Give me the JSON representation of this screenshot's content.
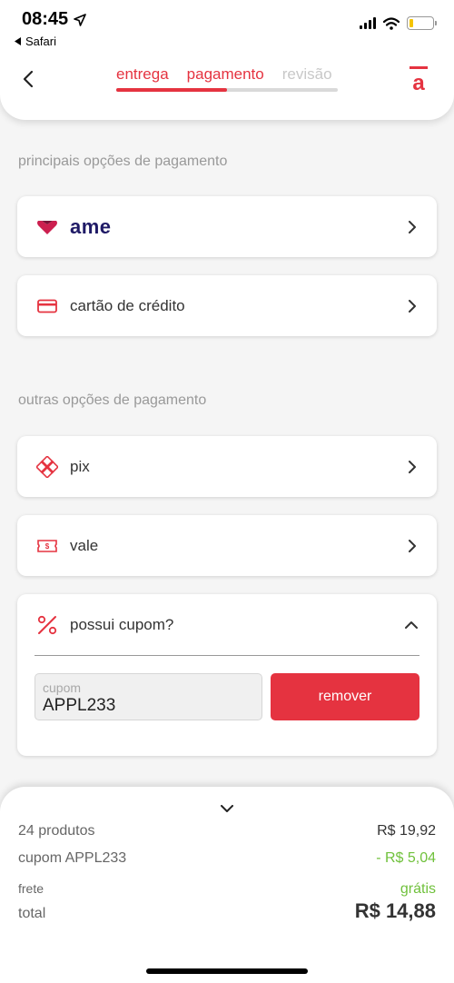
{
  "status_bar": {
    "time": "08:45",
    "back_app": "Safari",
    "battery_level": 0.15
  },
  "header": {
    "steps": [
      {
        "label": "entrega",
        "color": "#e53340"
      },
      {
        "label": "pagamento",
        "color": "#e53340"
      },
      {
        "label": "revisão",
        "color": "#c8c8c8"
      }
    ],
    "progress": 0.5,
    "logo_letter": "a"
  },
  "sections": {
    "main_title": "principais opções de pagamento",
    "other_title": "outras opções de pagamento"
  },
  "main_options": [
    {
      "id": "ame",
      "label": "ame",
      "icon": "ame-heart-icon"
    },
    {
      "id": "credit",
      "label": "cartão de crédito",
      "icon": "credit-card-icon"
    }
  ],
  "other_options": [
    {
      "id": "pix",
      "label": "pix",
      "icon": "pix-icon"
    },
    {
      "id": "vale",
      "label": "vale",
      "icon": "voucher-icon"
    }
  ],
  "coupon": {
    "title": "possui cupom?",
    "input_label": "cupom",
    "input_value": "APPL233",
    "button_label": "remover"
  },
  "summary": {
    "products_label": "24 produtos",
    "products_value": "R$ 19,92",
    "coupon_label": "cupom APPL233",
    "coupon_value": "- R$ 5,04",
    "shipping_label": "frete",
    "shipping_value": "grátis",
    "total_label": "total",
    "total_value": "R$ 14,88"
  },
  "colors": {
    "accent": "#e53340",
    "success": "#70c13c",
    "ame_brand": "#1f1a66"
  }
}
